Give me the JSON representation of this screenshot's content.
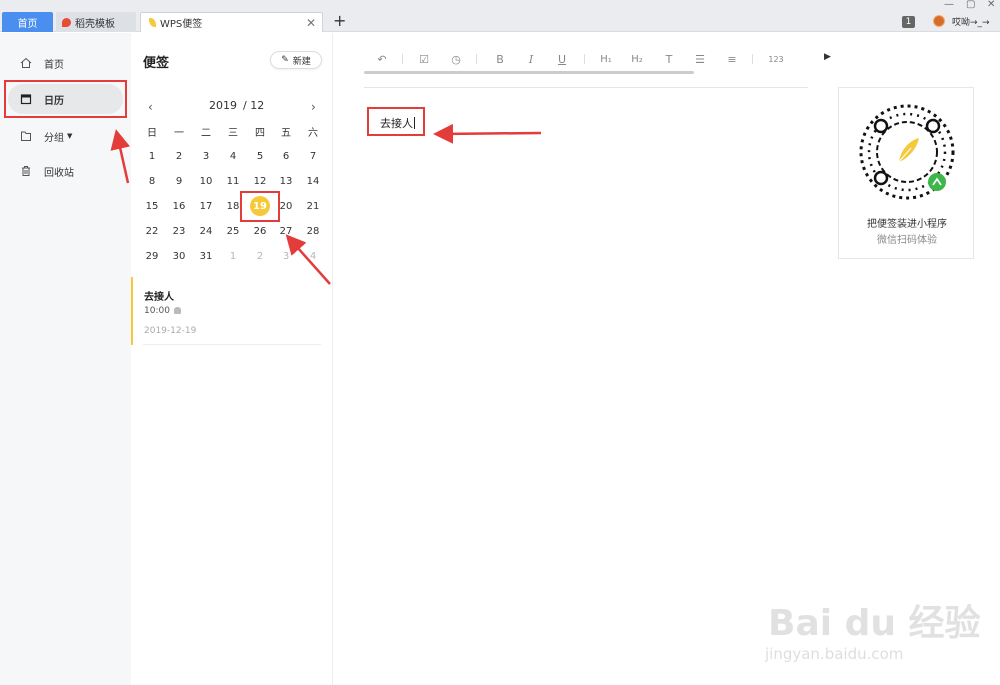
{
  "titlebar": {
    "tabs": [
      {
        "label": "首页"
      },
      {
        "label": "稻壳模板"
      },
      {
        "label": "WPS便签"
      }
    ],
    "badge": "1",
    "username": "哎呦→_→"
  },
  "sidebar": {
    "items": [
      {
        "label": "首页",
        "icon": "home-icon"
      },
      {
        "label": "日历",
        "icon": "calendar-icon"
      },
      {
        "label": "分组",
        "icon": "folder-icon"
      },
      {
        "label": "回收站",
        "icon": "trash-icon"
      }
    ]
  },
  "notes_panel": {
    "title": "便签",
    "new_button": "新建"
  },
  "calendar": {
    "year": "2019",
    "month": "/ 12",
    "weekdays": [
      "日",
      "一",
      "二",
      "三",
      "四",
      "五",
      "六"
    ],
    "weeks": [
      [
        "1",
        "2",
        "3",
        "4",
        "5",
        "6",
        "7"
      ],
      [
        "8",
        "9",
        "10",
        "11",
        "12",
        "13",
        "14"
      ],
      [
        "15",
        "16",
        "17",
        "18",
        "19",
        "20",
        "21"
      ],
      [
        "22",
        "23",
        "24",
        "25",
        "26",
        "27",
        "28"
      ],
      [
        "29",
        "30",
        "31",
        "1",
        "2",
        "3",
        "4"
      ]
    ],
    "selected_day": "19"
  },
  "note": {
    "title": "去接人",
    "time": "10:00",
    "date": "2019-12-19"
  },
  "editor": {
    "content": "去接人"
  },
  "qr": {
    "caption": "把便签装进小程序",
    "sub": "微信扫码体验"
  },
  "watermark": {
    "brand": "Bai du 经验",
    "url": "jingyan.baidu.com"
  },
  "colors": {
    "accent_blue": "#4a8ff0",
    "highlight_yellow": "#f6c93a",
    "annotation_red": "#e43b3b"
  }
}
